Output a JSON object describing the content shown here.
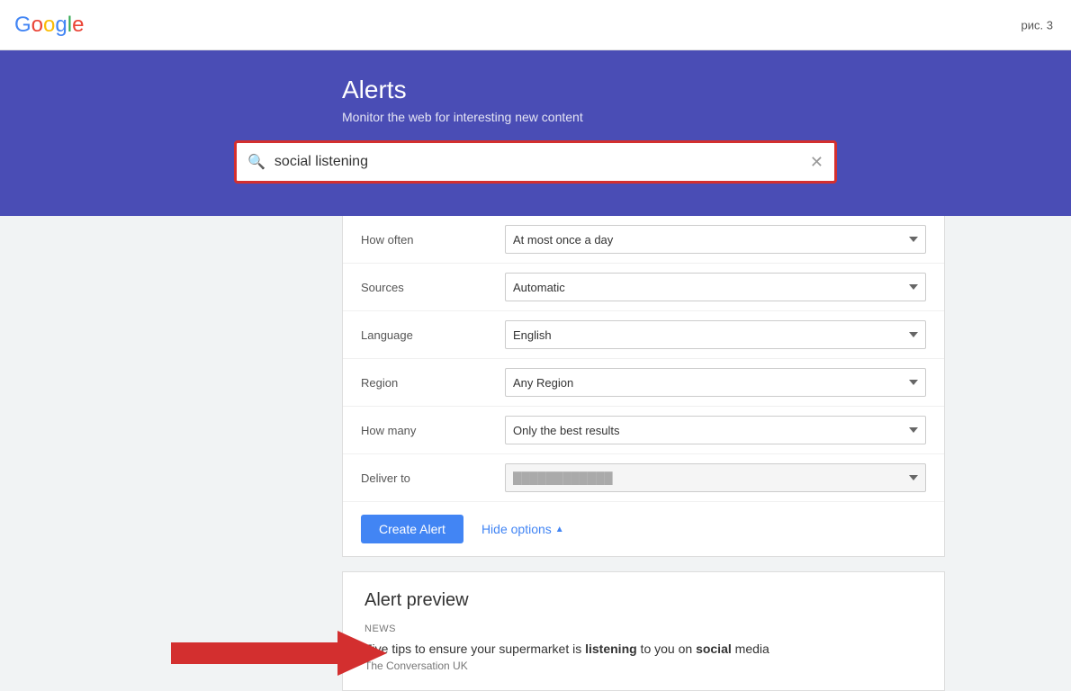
{
  "header": {
    "google_logo": "Google",
    "pic_label": "рис. 3"
  },
  "banner": {
    "title": "Alerts",
    "subtitle": "Monitor the web for interesting new content",
    "search_value": "social listening"
  },
  "options": {
    "rows": [
      {
        "label": "How often",
        "value": "At most once a day",
        "id": "how-often"
      },
      {
        "label": "Sources",
        "value": "Automatic",
        "id": "sources"
      },
      {
        "label": "Language",
        "value": "English",
        "id": "language"
      },
      {
        "label": "Region",
        "value": "Any Region",
        "id": "region"
      },
      {
        "label": "How many",
        "value": "Only the best results",
        "id": "how-many"
      },
      {
        "label": "Deliver to",
        "value": "",
        "id": "deliver-to"
      }
    ],
    "create_alert_label": "Create Alert",
    "hide_options_label": "Hide options"
  },
  "preview": {
    "title": "Alert preview",
    "news_label": "NEWS",
    "article_title_prefix": "Five tips to ensure your supermarket is ",
    "article_title_bold1": "listening",
    "article_title_mid": " to you on ",
    "article_title_bold2": "social",
    "article_title_suffix": " media",
    "article_source": "The Conversation UK"
  }
}
